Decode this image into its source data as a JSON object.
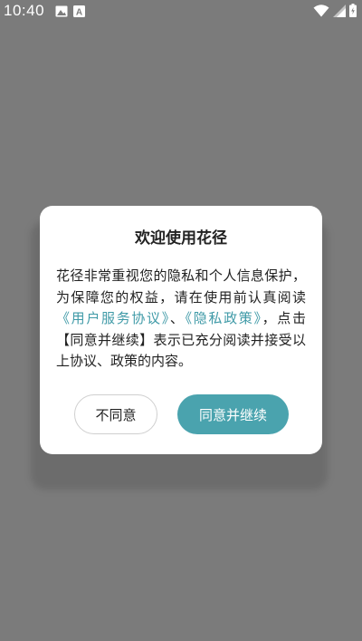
{
  "status_bar": {
    "time": "10:40",
    "icons": [
      "image-icon",
      "text-a-icon",
      "wifi-icon",
      "signal-icon",
      "battery-icon"
    ]
  },
  "dialog": {
    "title": "欢迎使用花径",
    "body": {
      "p1": "花径非常重视您的隐私和个人信息保护，为保障您的权益，请在使用前认真阅读",
      "link_terms": "《用户服务协议》",
      "sep": "、",
      "link_privacy": "《隐私政策》",
      "p2": "，点击【同意并继续】表示已充分阅读并接受以上协议、政策的内容。"
    },
    "disagree_label": "不同意",
    "agree_label": "同意并继续"
  },
  "colors": {
    "overlay": "#7b7b7b",
    "accent": "#4aa3ae",
    "link": "#3f9aa7"
  }
}
